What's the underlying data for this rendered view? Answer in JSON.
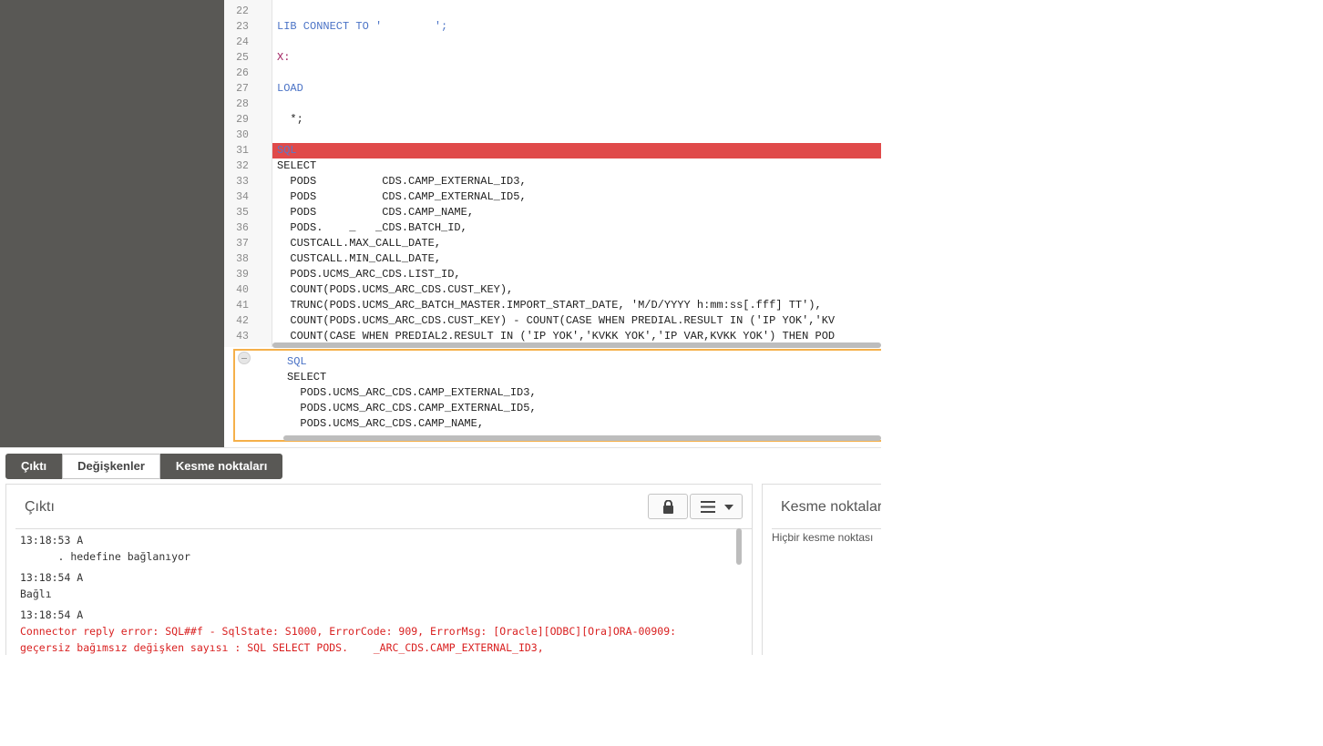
{
  "editor": {
    "lines": [
      {
        "num": "22",
        "code": ""
      },
      {
        "num": "23",
        "code": "LIB CONNECT TO '        ';"
      },
      {
        "num": "24",
        "code": ""
      },
      {
        "num": "25",
        "code": "X:"
      },
      {
        "num": "26",
        "code": ""
      },
      {
        "num": "27",
        "code": "LOAD"
      },
      {
        "num": "28",
        "code": ""
      },
      {
        "num": "29",
        "code": "  *;"
      },
      {
        "num": "30",
        "code": ""
      },
      {
        "num": "31",
        "code": "SQL"
      },
      {
        "num": "32",
        "code": "SELECT"
      },
      {
        "num": "33",
        "code": "  PODS          CDS.CAMP_EXTERNAL_ID3,"
      },
      {
        "num": "34",
        "code": "  PODS          CDS.CAMP_EXTERNAL_ID5,"
      },
      {
        "num": "35",
        "code": "  PODS          CDS.CAMP_NAME,"
      },
      {
        "num": "36",
        "code": "  PODS.    _   _CDS.BATCH_ID,"
      },
      {
        "num": "37",
        "code": "  CUSTCALL.MAX_CALL_DATE,"
      },
      {
        "num": "38",
        "code": "  CUSTCALL.MIN_CALL_DATE,"
      },
      {
        "num": "39",
        "code": "  PODS.UCMS_ARC_CDS.LIST_ID,"
      },
      {
        "num": "40",
        "code": "  COUNT(PODS.UCMS_ARC_CDS.CUST_KEY),"
      },
      {
        "num": "41",
        "code": "  TRUNC(PODS.UCMS_ARC_BATCH_MASTER.IMPORT_START_DATE, 'M/D/YYYY h:mm:ss[.fff] TT'),"
      },
      {
        "num": "42",
        "code": "  COUNT(PODS.UCMS_ARC_CDS.CUST_KEY) - COUNT(CASE WHEN PREDIAL.RESULT IN ('IP YOK','KV"
      },
      {
        "num": "43",
        "code": "  COUNT(CASE WHEN PREDIAL2.RESULT IN ('IP YOK','KVKK YOK','IP VAR,KVKK YOK') THEN POD"
      }
    ],
    "highlighted_line": "31"
  },
  "preview": {
    "lines": [
      "SQL",
      "SELECT",
      "  PODS.UCMS_ARC_CDS.CAMP_EXTERNAL_ID3,",
      "  PODS.UCMS_ARC_CDS.CAMP_EXTERNAL_ID5,",
      "  PODS.UCMS_ARC_CDS.CAMP_NAME,"
    ]
  },
  "tabs": [
    {
      "label": "Çıktı",
      "active": true
    },
    {
      "label": "Değişkenler",
      "active": false
    },
    {
      "label": "Kesme noktaları",
      "active": true
    }
  ],
  "output": {
    "title": "Çıktı",
    "lock_icon": "lock-icon",
    "menu_icon": "menu-icon",
    "log": [
      {
        "time": "13:18:53 A",
        "messages": [
          "      . hedefine bağlanıyor"
        ],
        "error": false
      },
      {
        "time": "13:18:54 A",
        "messages": [
          "Bağlı"
        ],
        "error": false
      },
      {
        "time": "13:18:54 A",
        "messages": [
          "Connector reply error: SQL##f - SqlState: S1000, ErrorCode: 909, ErrorMsg: [Oracle][ODBC][Ora]ORA-00909:",
          "geçersiz bağımsız değişken sayısı : SQL SELECT PODS.    _ARC_CDS.CAMP_EXTERNAL_ID3,"
        ],
        "error": true
      }
    ]
  },
  "breakpoints": {
    "title": "Kesme noktaları",
    "empty_text": "Hiçbir kesme noktası"
  },
  "colors": {
    "sidebar": "#595855",
    "highlight": "#e04a4a",
    "preview_border": "#f5b04a",
    "error_text": "#d92020",
    "keyword": "#4b73c6"
  }
}
